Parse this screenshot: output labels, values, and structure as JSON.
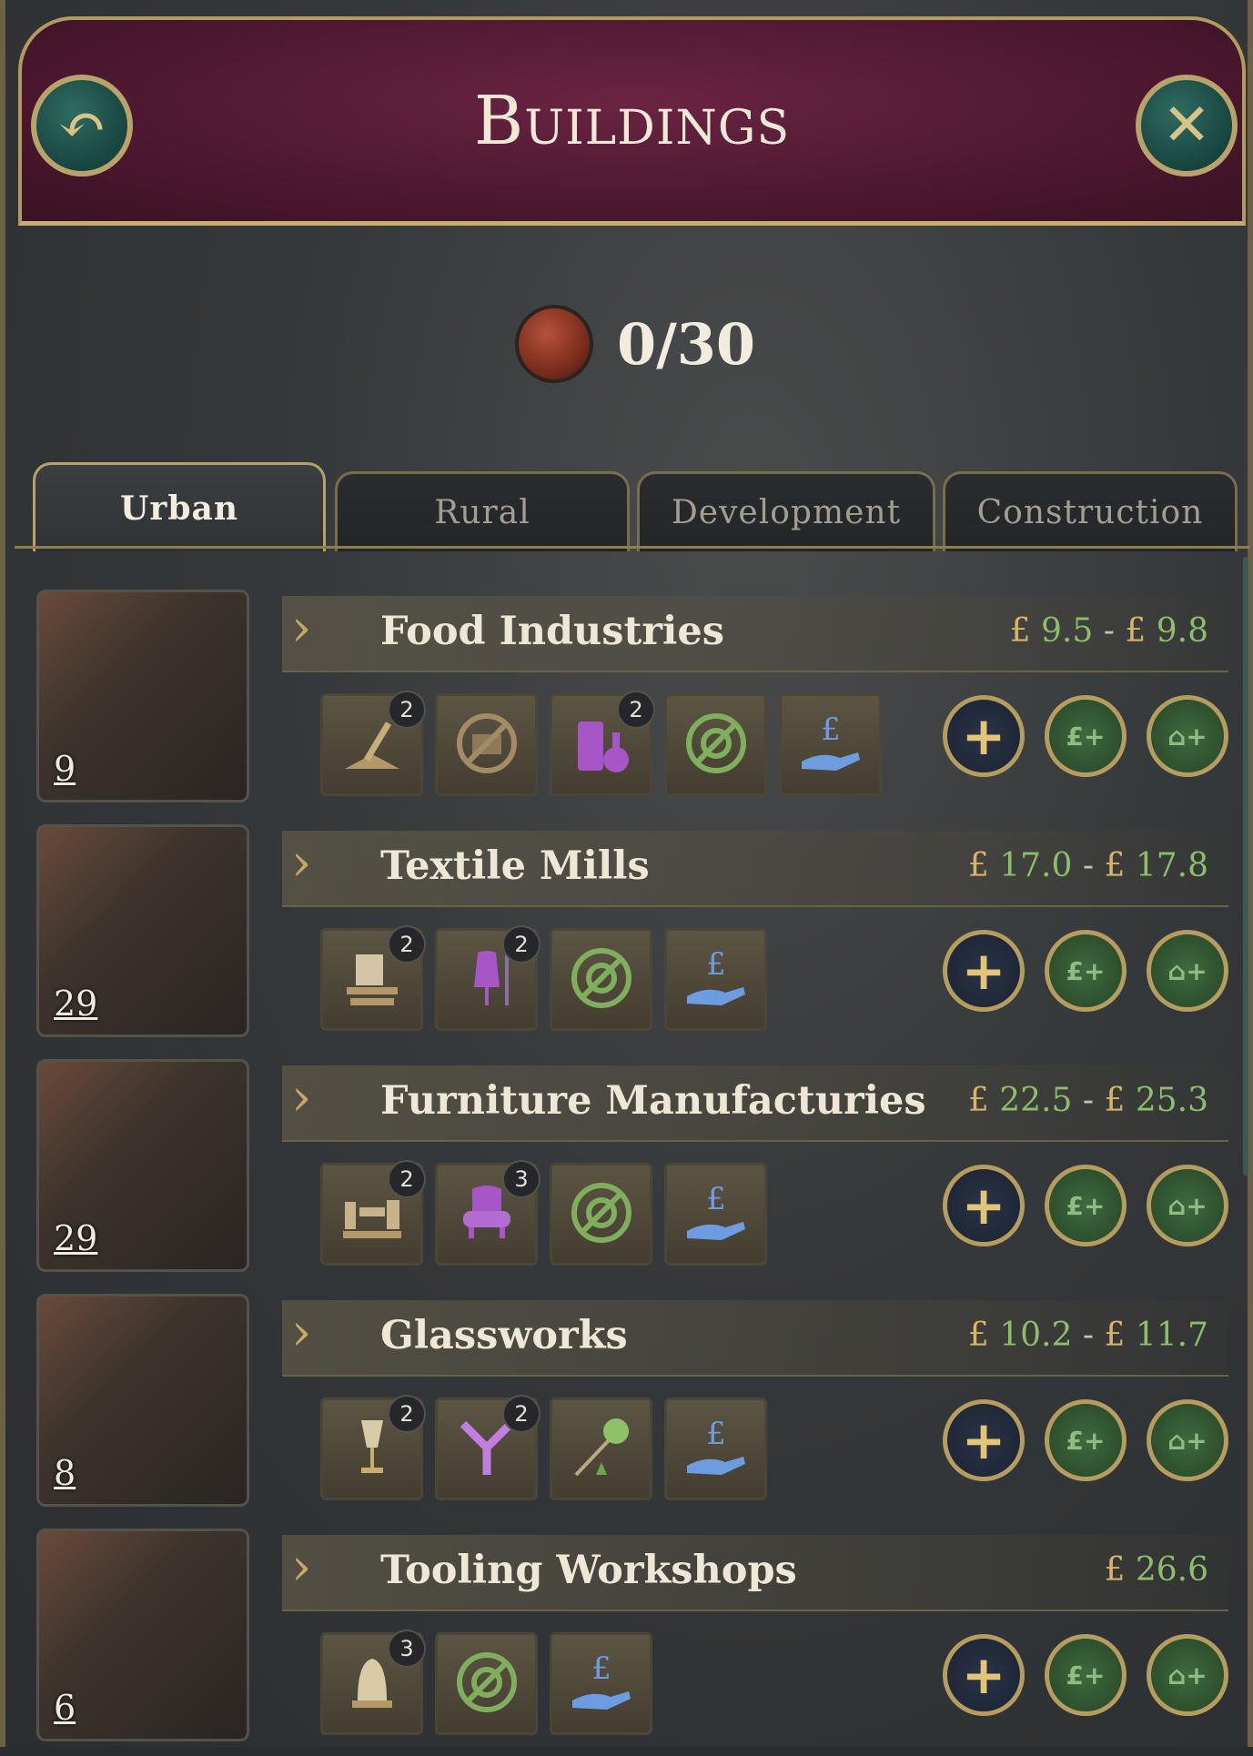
{
  "header": {
    "title": "Buildings",
    "back_icon": "undo-arrow-icon",
    "close_icon": "close-x-icon"
  },
  "counter": {
    "value": "0/30",
    "icon": "construction-points-icon"
  },
  "tabs": [
    {
      "label": "Urban",
      "active": true
    },
    {
      "label": "Rural",
      "active": false
    },
    {
      "label": "Development",
      "active": false
    },
    {
      "label": "Construction",
      "active": false
    }
  ],
  "colors": {
    "header_bg": "#5a1c36",
    "gold": "#c7ae6c",
    "price_green": "#8cbf6a",
    "currency_gold": "#d7b46a"
  },
  "buildings": [
    {
      "name": "Food Industries",
      "count": "9",
      "price_low": "9.5",
      "price_high": "9.8",
      "slots": [
        {
          "icon": "grain-scoop-icon",
          "badge": "2"
        },
        {
          "icon": "disabled-canning-icon",
          "badge": ""
        },
        {
          "icon": "distillery-icon",
          "badge": "2"
        },
        {
          "icon": "disabled-automation-icon",
          "badge": ""
        },
        {
          "icon": "pound-hand-ownership-icon",
          "badge": ""
        }
      ]
    },
    {
      "name": "Textile Mills",
      "count": "29",
      "price_low": "17.0",
      "price_high": "17.8",
      "slots": [
        {
          "icon": "loom-icon",
          "badge": "2"
        },
        {
          "icon": "dress-form-icon",
          "badge": "2"
        },
        {
          "icon": "disabled-automation-icon",
          "badge": ""
        },
        {
          "icon": "pound-hand-ownership-icon",
          "badge": ""
        }
      ]
    },
    {
      "name": "Furniture Manufacturies",
      "count": "29",
      "price_low": "22.5",
      "price_high": "25.3",
      "slots": [
        {
          "icon": "lathe-icon",
          "badge": "2"
        },
        {
          "icon": "armchair-icon",
          "badge": "3"
        },
        {
          "icon": "disabled-automation-icon",
          "badge": ""
        },
        {
          "icon": "pound-hand-ownership-icon",
          "badge": ""
        }
      ]
    },
    {
      "name": "Glassworks",
      "count": "8",
      "price_low": "10.2",
      "price_high": "11.7",
      "slots": [
        {
          "icon": "goblet-icon",
          "badge": "2"
        },
        {
          "icon": "split-y-icon",
          "badge": "2"
        },
        {
          "icon": "glassblowing-icon",
          "badge": ""
        },
        {
          "icon": "pound-hand-ownership-icon",
          "badge": ""
        }
      ]
    },
    {
      "name": "Tooling Workshops",
      "count": "6",
      "price_single": "26.6",
      "slots": [
        {
          "icon": "bell-machine-icon",
          "badge": "3"
        },
        {
          "icon": "disabled-automation-icon",
          "badge": ""
        },
        {
          "icon": "pound-hand-ownership-icon",
          "badge": ""
        }
      ]
    }
  ],
  "currency_symbol": "£",
  "price_separator": "-",
  "actions": {
    "plus": "+",
    "money": "£+",
    "house": "⌂+"
  }
}
